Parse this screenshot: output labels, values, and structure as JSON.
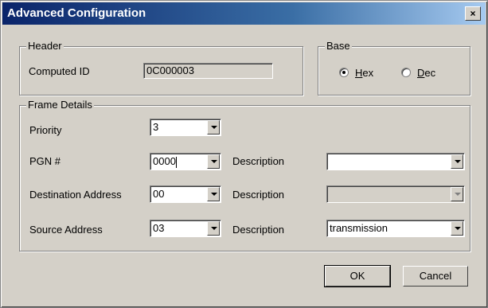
{
  "window": {
    "title": "Advanced Configuration",
    "close_label": "×"
  },
  "header_group": {
    "legend": "Header",
    "computed_id_label": "Computed ID",
    "computed_id_value": "0C000003"
  },
  "base_group": {
    "legend": "Base",
    "options": [
      {
        "label_underline": "H",
        "label_rest": "ex",
        "selected": true
      },
      {
        "label_underline": "D",
        "label_rest": "ec",
        "selected": false
      }
    ]
  },
  "frame_group": {
    "legend": "Frame Details",
    "priority_label": "Priority",
    "priority_value": "3",
    "pgn_label": "PGN #",
    "pgn_value": "0000",
    "pgn_desc_label": "Description",
    "pgn_desc_value": "",
    "dest_label": "Destination Address",
    "dest_value": "00",
    "dest_desc_label": "Description",
    "dest_desc_value": "",
    "src_label": "Source Address",
    "src_value": "03",
    "src_desc_label": "Description",
    "src_desc_value": "transmission"
  },
  "buttons": {
    "ok": "OK",
    "cancel": "Cancel"
  }
}
